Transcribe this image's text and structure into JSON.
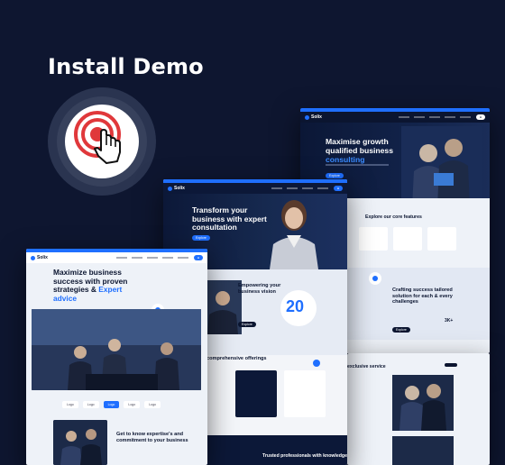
{
  "page": {
    "title": "Install Demo"
  },
  "accent_color": "#1f6fff",
  "click_icon": {
    "name": "click-pointer-icon",
    "ring_color": "#e0383b"
  },
  "screens": {
    "back": {
      "logo": "Solix",
      "hero_line1": "Maximise growth",
      "hero_line2": "qualified business",
      "hero_accent": "consulting",
      "features_title": "Explore our core features",
      "craft_title": "Crafting success tailored solution for each & every challenges",
      "stat": "3K+",
      "exclusive": "exclusive service"
    },
    "mid": {
      "logo": "Solix",
      "hero": "Transform your business with expert consultation",
      "empower": "Empowering your business vision",
      "stat": "20",
      "comprehensive": "comprehensive offerings",
      "trusted": "Trusted professionals with knowledge"
    },
    "front": {
      "logo": "Solix",
      "hero_line": "Maximize business success with proven strategies &",
      "hero_accent": "Expert advice",
      "logos": [
        "Logo",
        "Logo",
        "Logo",
        "Logo",
        "Logo"
      ],
      "know": "Get to know expertise's and commitment to your business"
    }
  }
}
